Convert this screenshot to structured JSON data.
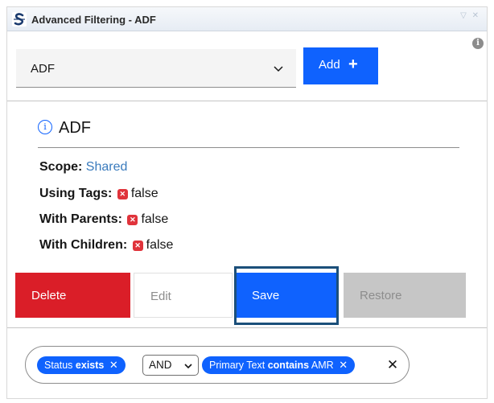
{
  "window": {
    "title": "Advanced Filtering - ADF",
    "controls": "▽ ✕"
  },
  "info_icon": "i",
  "filter_select": {
    "value": "ADF"
  },
  "add_button": {
    "label": "Add",
    "icon": "+"
  },
  "filter": {
    "icon": "i",
    "name": "ADF",
    "properties": [
      {
        "key": "Scope:",
        "value": "Shared"
      },
      {
        "key": "Using Tags:",
        "badge": "✕",
        "value": "false"
      },
      {
        "key": "With Parents:",
        "badge": "✕",
        "value": "false"
      },
      {
        "key": "With Children:",
        "badge": "✕",
        "value": "false"
      }
    ]
  },
  "actions": {
    "delete": "Delete",
    "edit": "Edit",
    "save": "Save",
    "restore": "Restore"
  },
  "query": {
    "tag1": {
      "field": "Status",
      "op": "exists",
      "value": "",
      "remove": "✕"
    },
    "combinator": "AND",
    "tag2": {
      "field": "Primary Text",
      "op": "contains",
      "value": "AMR",
      "remove": "✕"
    },
    "clear": "✕"
  },
  "colors": {
    "primary": "#0f62fe",
    "danger": "#da1e28",
    "disabled": "#c6c6c6",
    "link": "#3a7bbd",
    "focus": "#1b4f7a"
  }
}
